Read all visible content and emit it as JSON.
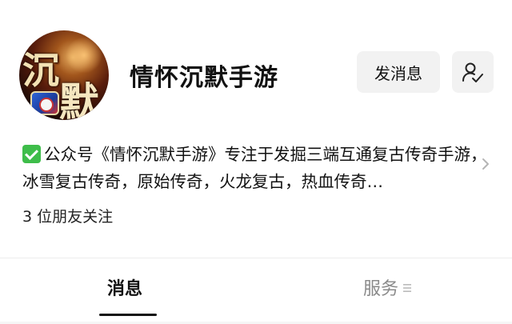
{
  "account": {
    "name": "情怀沉默手游",
    "avatar_text": [
      "沉",
      "默"
    ]
  },
  "actions": {
    "send_message_label": "发消息",
    "follow_icon": "person-check-icon"
  },
  "description": {
    "icon": "green-check-icon",
    "text": "公众号《情怀沉默手游》专注于发掘三端互通复古传奇手游，冰雪复古传奇，原始传奇，火龙复古，热血传奇…"
  },
  "followers_text": "3 位朋友关注",
  "tabs": [
    {
      "label": "消息",
      "active": true
    },
    {
      "label": "服务",
      "active": false
    }
  ],
  "colors": {
    "check_green": "#3ebd4a",
    "button_bg": "#f2f2f2",
    "inactive_tab": "#8a8a8a"
  }
}
